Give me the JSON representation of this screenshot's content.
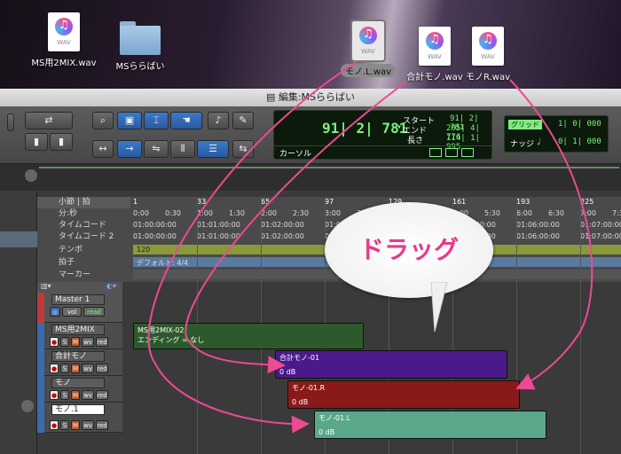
{
  "desktop": {
    "icons": [
      {
        "label": "MS用2MIX.wav",
        "type": "wav",
        "selected": false
      },
      {
        "label": "MSららばい",
        "type": "folder",
        "selected": false
      },
      {
        "label": "モノ.L.wav",
        "type": "wav",
        "selected": true
      },
      {
        "label": "合計モノ.wav",
        "type": "wav",
        "selected": false
      },
      {
        "label": "モノR.wav",
        "type": "wav",
        "selected": false
      }
    ],
    "wav_badge": "WAV"
  },
  "window": {
    "title": "編集:MSららばい"
  },
  "counter": {
    "main": "91| 2| 781",
    "start_label": "スタート",
    "start": "91| 2| 781",
    "end_label": "エンド",
    "end": "205| 4| 776",
    "length_label": "長さ",
    "length": "114| 1| 995",
    "cursor_label": "カーソル"
  },
  "grid_panel": {
    "grid_label": "グリッド",
    "grid_value": "1| 0| 000",
    "nudge_label": "ナッジ",
    "nudge_value": "0| 1| 000"
  },
  "rulers": {
    "rows": [
      "小節 | 拍",
      "分:秒",
      "タイムコード",
      "タイムコード 2",
      "テンポ",
      "拍子",
      "マーカー"
    ],
    "bars": [
      "1",
      "33",
      "65",
      "97",
      "129",
      "161",
      "193",
      "225"
    ],
    "minsec": [
      "0:00",
      "0:30",
      "1:00",
      "1:30",
      "2:00",
      "2:30",
      "3:00",
      "3:30",
      "4:00",
      "4:30",
      "5:00",
      "5:30",
      "6:00",
      "6:30",
      "7:00",
      "7:30"
    ],
    "timecode": [
      "01:00:00:00",
      "01:01:00:00",
      "01:02:00:00",
      "01:03:00:00",
      "01:04:00:00",
      "01:05:00:00",
      "01:06:00:00",
      "01:07:00:00"
    ],
    "timecode2": [
      "01:00:00:00",
      "01:01:00:00",
      "01:02:00:00",
      "01:03:00:00",
      "01:04:00:00",
      "01:05:00:00",
      "01:06:00:00",
      "01:07:00:00"
    ],
    "tempo": "120",
    "meter": "デフォルト: 4/4"
  },
  "tracks": [
    {
      "name": "Master 1",
      "vol": "vol",
      "read": "read"
    },
    {
      "name": "MS用2MIX",
      "buttons": [
        "S",
        "M",
        "wv",
        "red"
      ]
    },
    {
      "name": "合計モノ",
      "buttons": [
        "S",
        "M",
        "wv",
        "red"
      ]
    },
    {
      "name": "モノ",
      "buttons": [
        "S",
        "M",
        "wv",
        "red"
      ]
    },
    {
      "name": "モノ.1",
      "buttons": [
        "S",
        "M",
        "wv",
        "red"
      ]
    }
  ],
  "clips": [
    {
      "name": "MS用2MIX-02",
      "sub": "エンディング = なし",
      "color": "#2d5a2d"
    },
    {
      "name": "合計モノ-01",
      "db": "0 dB",
      "color": "#4a1a8a"
    },
    {
      "name": "モノ-01.R",
      "db": "0 dB",
      "color": "#8a1a1a"
    },
    {
      "name": "モノ-01.L",
      "db": "0 dB",
      "color": "#5aa88a"
    }
  ],
  "callout": {
    "text": "ドラッグ"
  },
  "colors": {
    "arrow": "#ec4a92",
    "accent": "#3a7ac8"
  }
}
